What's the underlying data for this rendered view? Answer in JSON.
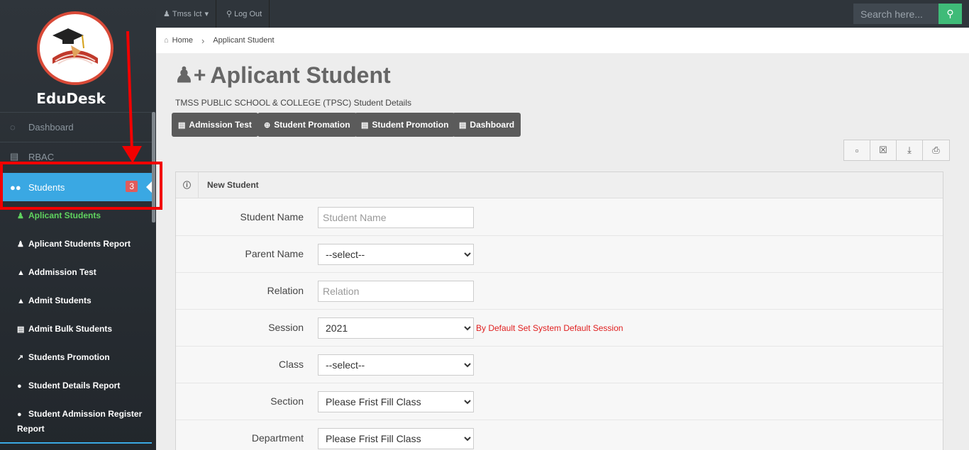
{
  "brand": {
    "name": "EduDesk"
  },
  "sidebar": {
    "items": [
      {
        "label": "Dashboard",
        "icon": "dashboard-icon"
      },
      {
        "label": "RBAC",
        "icon": "list-icon"
      },
      {
        "label": "Students",
        "icon": "users-icon",
        "badge": "3"
      }
    ],
    "subitems": [
      {
        "label": "Aplicant Students",
        "icon": "user-plus-icon"
      },
      {
        "label": "Aplicant Students Report",
        "icon": "user-plus-icon"
      },
      {
        "label": "Addmission Test",
        "icon": "graduation-cap-icon"
      },
      {
        "label": "Admit Students",
        "icon": "graduation-cap-icon"
      },
      {
        "label": "Admit Bulk Students",
        "icon": "id-card-icon"
      },
      {
        "label": "Students Promotion",
        "icon": "line-chart-icon"
      },
      {
        "label": "Student Details Report",
        "icon": "circle-icon"
      },
      {
        "label": "Student Admission Register Report",
        "icon": "circle-icon"
      }
    ]
  },
  "topbar": {
    "user_label": "Tmss Ict",
    "logout_label": "Log Out",
    "search_placeholder": "Search here..."
  },
  "breadcrumb": {
    "home": "Home",
    "current": "Applicant Student"
  },
  "page": {
    "title": "Aplicant Student",
    "subtitle": "TMSS PUBLIC SCHOOL & COLLEGE (TPSC) Student Details",
    "actions": [
      "Admission Test",
      "Student Promation",
      "Student Promotion",
      "Dashboard"
    ]
  },
  "export_buttons": [
    "pdf-icon",
    "excel-icon",
    "download-icon",
    "print-icon"
  ],
  "form": {
    "panel_title": "New Student",
    "fields": [
      {
        "label": "Student Name",
        "type": "text",
        "placeholder": "Student Name",
        "value": ""
      },
      {
        "label": "Parent Name",
        "type": "select",
        "value": "--select--"
      },
      {
        "label": "Relation",
        "type": "text",
        "placeholder": "Relation",
        "value": ""
      },
      {
        "label": "Session",
        "type": "select",
        "value": "2021",
        "help": "By Default Set System Default Session"
      },
      {
        "label": "Class",
        "type": "select",
        "value": "--select--"
      },
      {
        "label": "Section",
        "type": "select",
        "value": "Please Frist Fill Class"
      },
      {
        "label": "Department",
        "type": "select",
        "value": "Please Frist Fill Class"
      }
    ]
  },
  "colors": {
    "accent": "#3aa8e3",
    "highlight": "#f20000",
    "success": "#3fbb78"
  }
}
